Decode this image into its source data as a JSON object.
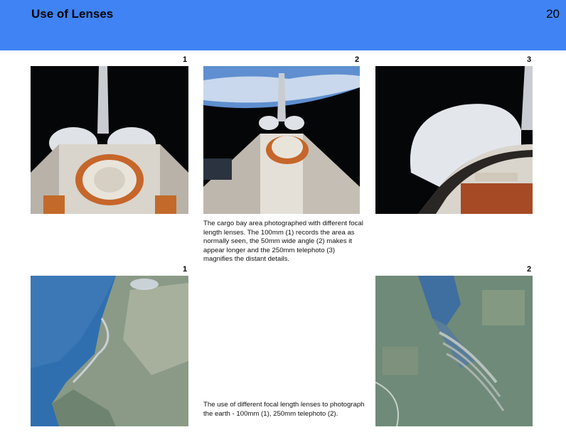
{
  "header": {
    "title": "Use of Lenses",
    "page_number": "20"
  },
  "row1": {
    "labels": [
      "1",
      "2",
      "3"
    ],
    "images": [
      "cargo-bay-100mm-photo",
      "cargo-bay-50mm-photo",
      "cargo-bay-250mm-photo"
    ],
    "caption": "The cargo bay area photographed with different focal length lenses. The 100mm (1) records the area as normally seen, the 50mm wide angle (2) makes it appear longer and the 250mm telephoto (3) magnifies the distant details."
  },
  "row2": {
    "labels": [
      "1",
      "2"
    ],
    "images": [
      "earth-100mm-photo",
      "earth-250mm-photo"
    ],
    "caption": "The use of different focal length lenses to photograph the earth - 100mm (1), 250mm telephoto (2)."
  },
  "colors": {
    "header": "#3f83f4",
    "space": "#050608",
    "ocean": "#2f6fb0",
    "land": "#8a9a86"
  }
}
